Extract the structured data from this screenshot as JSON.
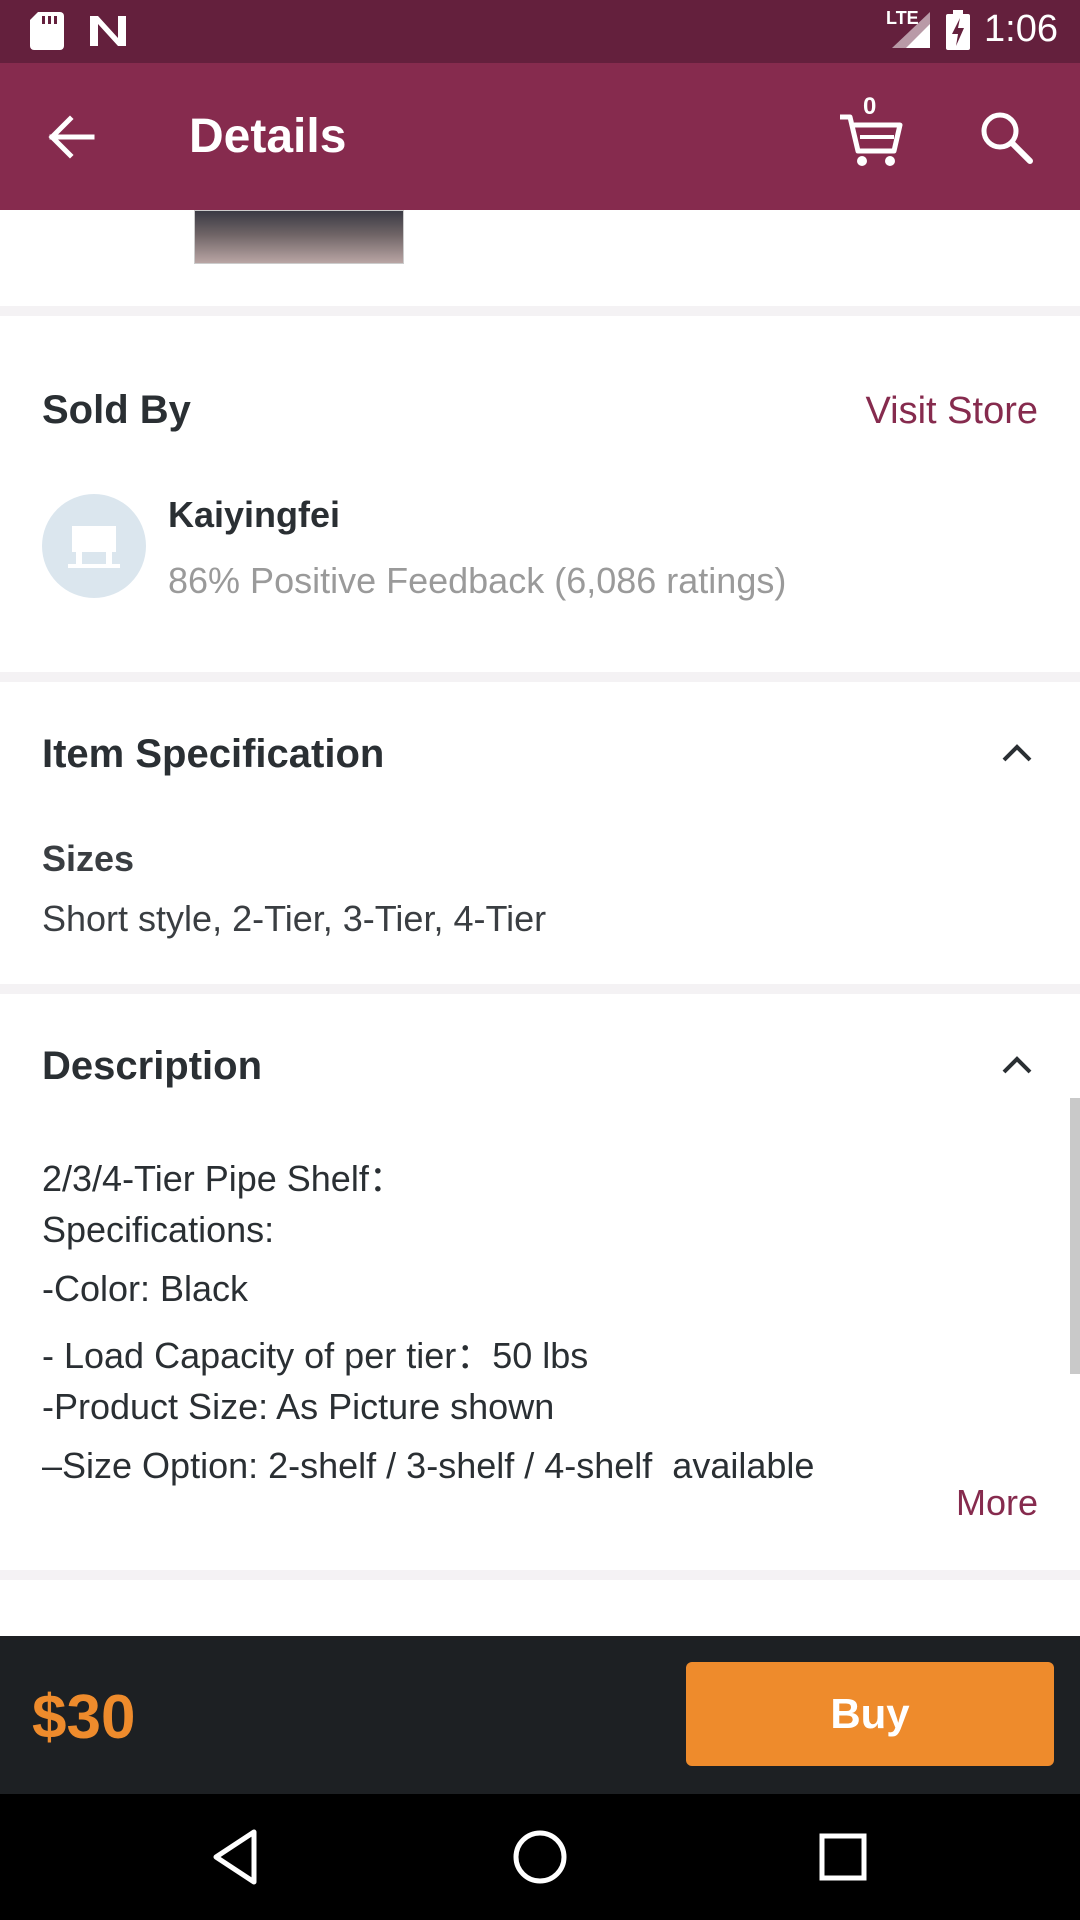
{
  "status_bar": {
    "network": "LTE",
    "time": "1:06"
  },
  "app_bar": {
    "title": "Details",
    "cart_count": "0"
  },
  "sold_by": {
    "title": "Sold By",
    "visit_store": "Visit Store",
    "store_name": "Kaiyingfei",
    "feedback": "86% Positive Feedback (6,086 ratings)"
  },
  "item_spec": {
    "title": "Item Specification",
    "label": "Sizes",
    "value": "Short style, 2-Tier, 3-Tier, 4-Tier"
  },
  "description": {
    "title": "Description",
    "lines": [
      "2/3/4-Tier Pipe Shelf：",
      "Specifications:",
      "-Color: Black",
      "- Load Capacity of per tier：50 lbs",
      "-Product Size: As Picture shown",
      "–Size Option: 2-shelf / 3-shelf / 4-shelf  available"
    ],
    "more": "More"
  },
  "purchase": {
    "price": "$30",
    "buy_label": "Buy"
  },
  "colors": {
    "status_bar": "#64203d",
    "app_bar": "#862b4e",
    "accent": "#ee8b2c",
    "bottom_bar": "#1d2023"
  }
}
